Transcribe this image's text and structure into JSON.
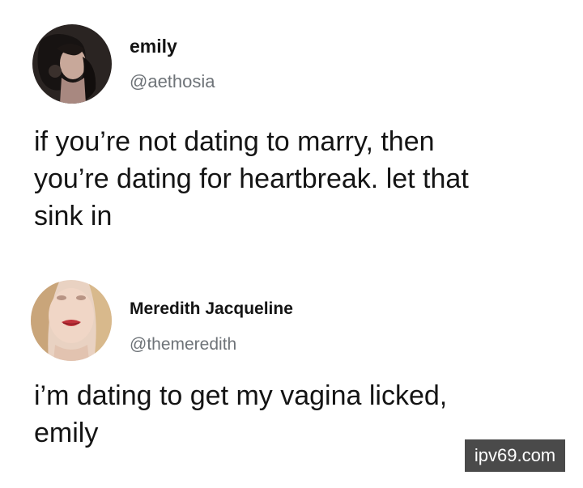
{
  "tweets": [
    {
      "name": "emily",
      "handle": "@aethosia",
      "avatar_icon": "avatar-photo",
      "text_lines": [
        "if you’re not dating to marry, then",
        "you’re dating for heartbreak. let that",
        "sink in"
      ]
    },
    {
      "name": "Meredith Jacqueline",
      "handle": "@themeredith",
      "avatar_icon": "avatar-photo",
      "text_lines": [
        "i’m dating to get my vagina licked,",
        "emily"
      ]
    }
  ],
  "watermark": "ipv69.com",
  "colors": {
    "text": "#141414",
    "handle": "#6e7378",
    "watermark_bg": "#4a4a4a"
  }
}
